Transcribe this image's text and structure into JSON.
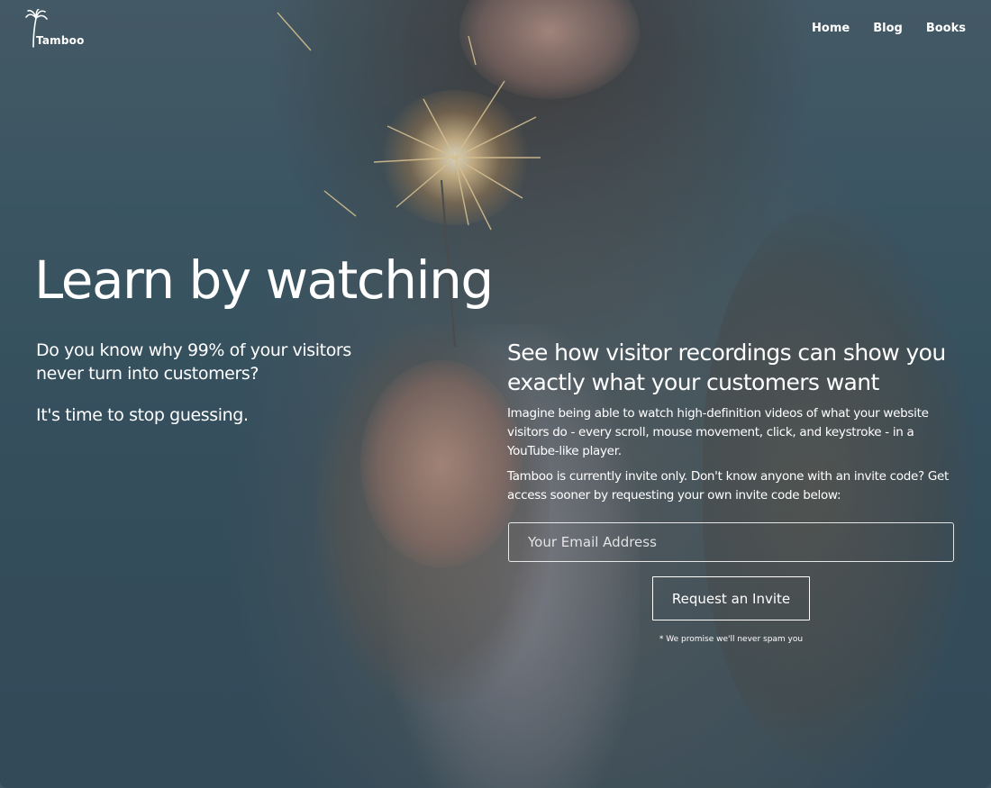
{
  "brand": {
    "name": "Tamboo",
    "logo_icon": "palm-tree-icon"
  },
  "nav": {
    "items": [
      {
        "label": "Home"
      },
      {
        "label": "Blog"
      },
      {
        "label": "Books"
      }
    ]
  },
  "hero": {
    "title": "Learn by watching",
    "question": "Do you know why 99% of your visitors never turn into customers?",
    "tagline": "It's time to stop guessing."
  },
  "signup": {
    "heading": "See how visitor recordings can show you exactly what your customers want",
    "description": "Imagine being able to watch high-definition videos of what your website visitors do - every scroll, mouse movement, click, and keystroke - in a YouTube-like player.",
    "invite_text": "Tamboo is currently invite only. Don't know anyone with an invite code? Get access sooner by requesting your own invite code below:",
    "email_placeholder": "Your Email Address",
    "button_label": "Request an Invite",
    "disclaimer": "* We promise we'll never spam you"
  },
  "colors": {
    "text": "#ffffff",
    "background": "#3f5561"
  }
}
